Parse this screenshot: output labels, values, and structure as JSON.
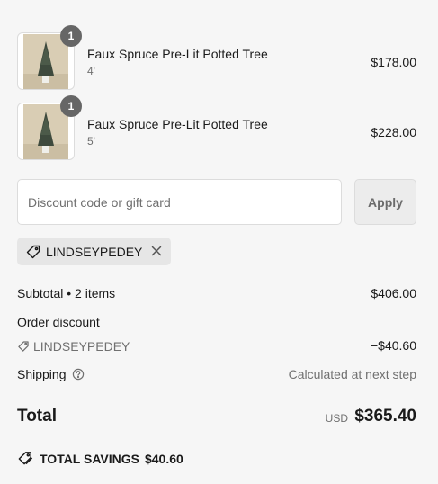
{
  "line_items": [
    {
      "title": "Faux Spruce Pre-Lit Potted Tree",
      "variant": "4'",
      "price": "$178.00",
      "quantity": "1"
    },
    {
      "title": "Faux Spruce Pre-Lit Potted Tree",
      "variant": "5'",
      "price": "$228.00",
      "quantity": "1"
    }
  ],
  "discount": {
    "placeholder": "Discount code or gift card",
    "apply_label": "Apply",
    "applied_code": "LINDSEYPEDEY"
  },
  "summary": {
    "subtotal_label": "Subtotal • 2 items",
    "subtotal_value": "$406.00",
    "order_discount_label": "Order discount",
    "discount_code": "LINDSEYPEDEY",
    "discount_value": "−$40.60",
    "shipping_label": "Shipping",
    "shipping_value": "Calculated at next step",
    "total_label": "Total",
    "currency": "USD",
    "total_value": "$365.40",
    "savings_label": "TOTAL SAVINGS",
    "savings_value": "$40.60"
  },
  "icons": {
    "tag": "tag-icon",
    "remove": "close-icon",
    "help": "question-circle-icon",
    "savings": "tags-icon"
  }
}
